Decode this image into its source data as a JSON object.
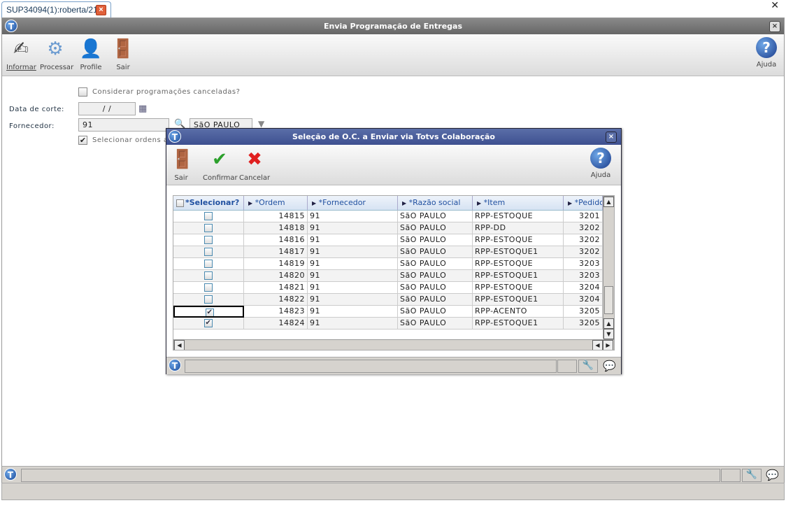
{
  "tab": {
    "label": "SUP34094(1):roberta/21"
  },
  "main": {
    "title": "Envia Programação de Entregas",
    "toolbar": [
      {
        "label": "Informar",
        "icon": "pen-icon"
      },
      {
        "label": "Processar",
        "icon": "gears-icon"
      },
      {
        "label": "Profile",
        "icon": "user-disk-icon"
      },
      {
        "label": "Sair",
        "icon": "exit-door-icon"
      }
    ],
    "help_label": "Ajuda",
    "form": {
      "cancel_check_label": "Considerar programações canceladas?",
      "cancel_checked": false,
      "date_label": "Data de corte:",
      "date_value": " / /",
      "supplier_label": "Fornecedor:",
      "supplier_code": "91",
      "supplier_name": "SãO PAULO",
      "select_check_label": "Selecionar ordens a e",
      "select_checked": true
    }
  },
  "dialog": {
    "title": "Seleção de O.C. a Enviar via Totvs Colaboração",
    "toolbar": [
      {
        "label": "Sair",
        "icon": "exit-door-icon"
      },
      {
        "label": "Confirmar",
        "icon": "check-icon"
      },
      {
        "label": "Cancelar",
        "icon": "x-icon"
      }
    ],
    "help_label": "Ajuda",
    "columns": [
      "*Selecionar?",
      "*Ordem",
      "*Fornecedor",
      "*Razão social",
      "*Item",
      "*Pedido"
    ],
    "rows": [
      {
        "sel": false,
        "ordem": "14815",
        "forn": "91",
        "razao": "SãO PAULO",
        "item": "RPP-ESTOQUE",
        "pedido": "3201"
      },
      {
        "sel": false,
        "ordem": "14818",
        "forn": "91",
        "razao": "SãO PAULO",
        "item": "RPP-DD",
        "pedido": "3202"
      },
      {
        "sel": false,
        "ordem": "14816",
        "forn": "91",
        "razao": "SãO PAULO",
        "item": "RPP-ESTOQUE",
        "pedido": "3202"
      },
      {
        "sel": false,
        "ordem": "14817",
        "forn": "91",
        "razao": "SãO PAULO",
        "item": "RPP-ESTOQUE1",
        "pedido": "3202"
      },
      {
        "sel": false,
        "ordem": "14819",
        "forn": "91",
        "razao": "SãO PAULO",
        "item": "RPP-ESTOQUE",
        "pedido": "3203"
      },
      {
        "sel": false,
        "ordem": "14820",
        "forn": "91",
        "razao": "SãO PAULO",
        "item": "RPP-ESTOQUE1",
        "pedido": "3203"
      },
      {
        "sel": false,
        "ordem": "14821",
        "forn": "91",
        "razao": "SãO PAULO",
        "item": "RPP-ESTOQUE",
        "pedido": "3204"
      },
      {
        "sel": false,
        "ordem": "14822",
        "forn": "91",
        "razao": "SãO PAULO",
        "item": "RPP-ESTOQUE1",
        "pedido": "3204"
      },
      {
        "sel": true,
        "ordem": "14823",
        "forn": "91",
        "razao": "SãO PAULO",
        "item": "RPP-ACENTO",
        "pedido": "3205"
      },
      {
        "sel": true,
        "ordem": "14824",
        "forn": "91",
        "razao": "SãO PAULO",
        "item": "RPP-ESTOQUE1",
        "pedido": "3205"
      }
    ]
  },
  "colors": {
    "dialog_title": "#4a5e9e",
    "header_text": "#2050a0",
    "status_bg": "#d6d3ce"
  }
}
